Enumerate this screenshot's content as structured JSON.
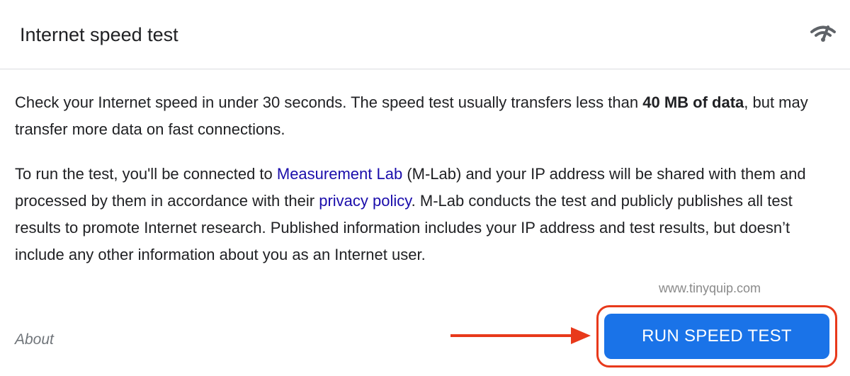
{
  "header": {
    "title": "Internet speed test",
    "icon": "speed-test-icon"
  },
  "intro": {
    "text_before": "Check your Internet speed in under 30 seconds. The speed test usually transfers less than ",
    "bold": "40 MB of data",
    "text_after": ", but may transfer more data on fast connections."
  },
  "privacy": {
    "text_1": "To run the test, you'll be connected to ",
    "link_mlab": "Measurement Lab",
    "text_2": " (M-Lab) and your IP address will be shared with them and processed by them in accordance with their ",
    "link_privacy": "privacy policy",
    "text_3": ". M-Lab conducts the test and publicly publishes all test results to promote Internet research. Published information includes your IP address and test results, but doesn’t include any other information about you as an Internet user."
  },
  "watermark": "www.tinyquip.com",
  "footer": {
    "about_label": "About",
    "run_button_label": "RUN SPEED TEST"
  },
  "colors": {
    "button_blue": "#1a73e8",
    "link_blue": "#1a0dab",
    "annotation_red": "#e8391b",
    "divider": "#dadce0"
  }
}
